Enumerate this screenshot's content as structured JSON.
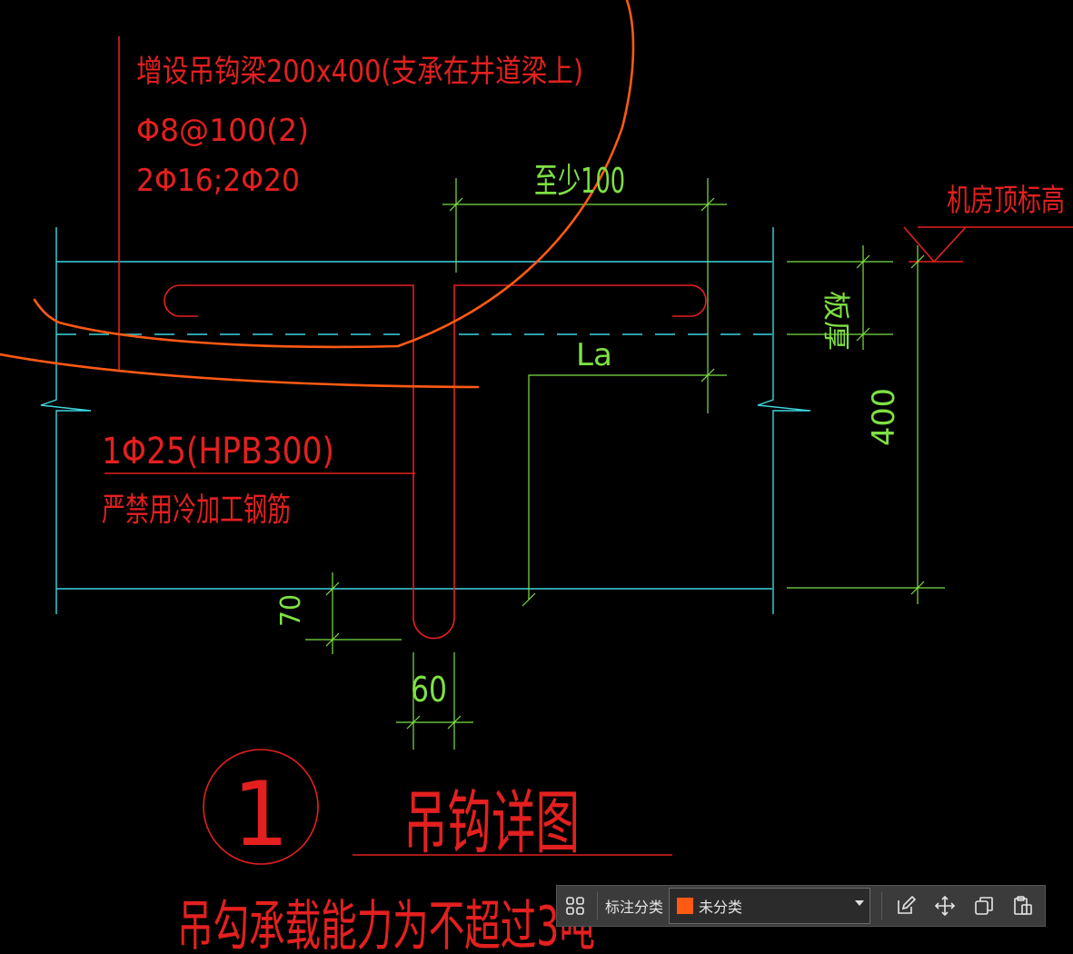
{
  "drawing": {
    "beam_note_1": "增设吊钩梁200x400(支承在井道梁上)",
    "beam_note_2": "Φ8@100(2)",
    "beam_note_3": "2Φ16;2Φ20",
    "dim_min_100": "至少100",
    "machine_room_top": "机房顶标高",
    "slab_thickness": "板厚",
    "la": "La",
    "bar_spec": "1Φ25(HPB300)",
    "no_cold_rebar": "严禁用冷加工钢筋",
    "dim_400": "400",
    "dim_70": "70",
    "dim_60": "60",
    "detail_number": "1",
    "detail_title": "吊钩详图",
    "capacity_note": "吊勾承载能力为不超过3吨"
  },
  "colors": {
    "red": "#e3201f",
    "green": "#7ee043",
    "cyan": "#3fd6e0",
    "orange": "#ff5a14",
    "background": "#000000"
  },
  "toolbar": {
    "layout_icon": "grid-icon",
    "label": "标注分类",
    "select_value": "未分类",
    "swatch_color": "#ff5a14",
    "icons": [
      "edit-icon",
      "move-icon",
      "copy-icon",
      "paste-icon"
    ]
  }
}
